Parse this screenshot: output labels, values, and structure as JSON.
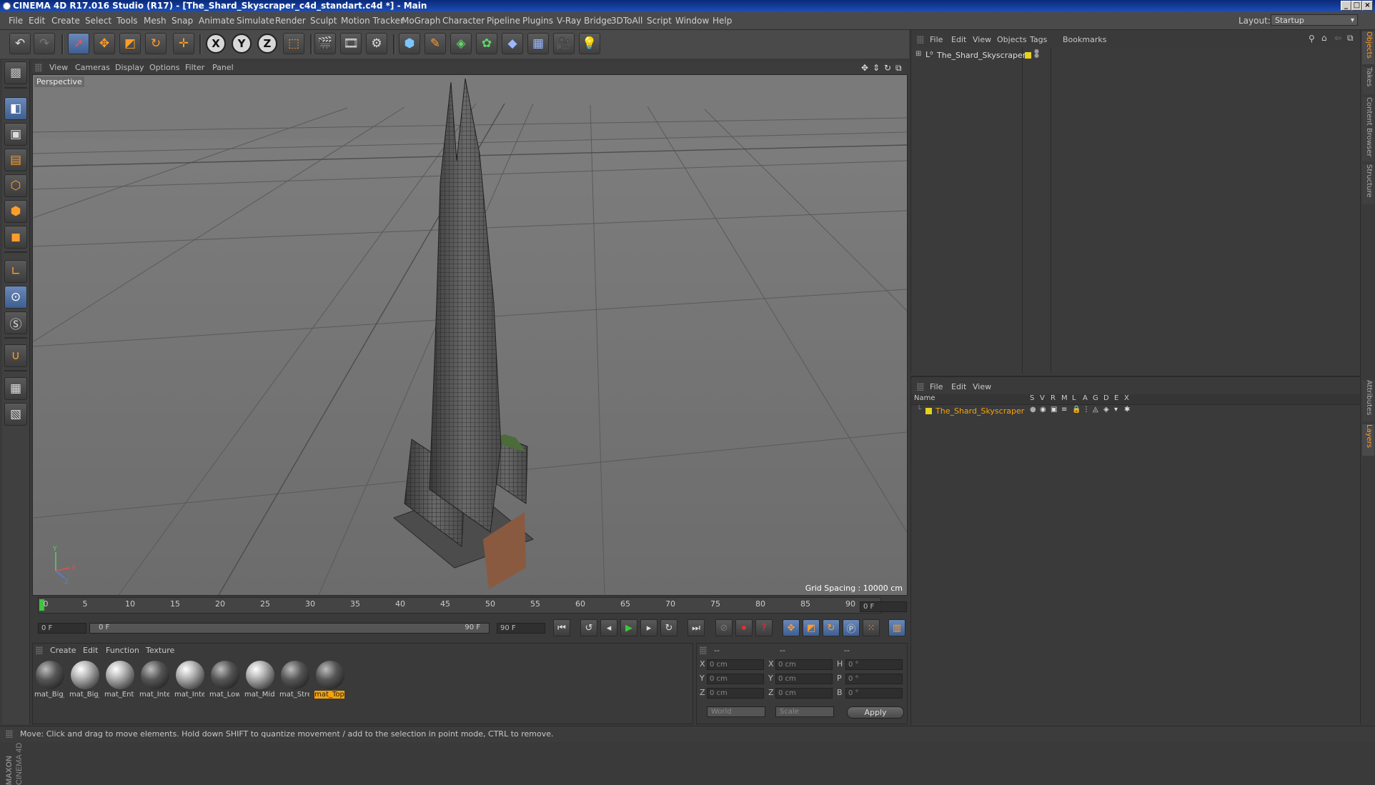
{
  "window": {
    "title": "CINEMA 4D R17.016 Studio (R17) - [The_Shard_Skyscraper_c4d_standart.c4d *] - Main"
  },
  "menubar": {
    "items": [
      "File",
      "Edit",
      "Create",
      "Select",
      "Tools",
      "Mesh",
      "Snap",
      "Animate",
      "Simulate",
      "Render",
      "Sculpt",
      "Motion Tracker",
      "MoGraph",
      "Character",
      "Pipeline",
      "Plugins",
      "V-Ray Bridge",
      "3DToAll",
      "Script",
      "Window",
      "Help"
    ],
    "layout_label": "Layout:",
    "layout_value": "Startup"
  },
  "viewport": {
    "menu": [
      "View",
      "Cameras",
      "Display",
      "Options",
      "Filter",
      "Panel"
    ],
    "label": "Perspective",
    "grid_spacing": "Grid Spacing : 10000 cm"
  },
  "timeline": {
    "ticks": [
      "0",
      "5",
      "10",
      "15",
      "20",
      "25",
      "30",
      "35",
      "40",
      "45",
      "50",
      "55",
      "60",
      "65",
      "70",
      "75",
      "80",
      "85",
      "90"
    ],
    "current_frame": "0 F",
    "start_frame": "0 F",
    "range_start": "0 F",
    "range_end": "90 F",
    "end_frame": "90 F"
  },
  "materials": {
    "menu": [
      "Create",
      "Edit",
      "Function",
      "Texture"
    ],
    "items": [
      "mat_Big_",
      "mat_Big_",
      "mat_Entr",
      "mat_Inte",
      "mat_Inte",
      "mat_Low",
      "mat_Midd",
      "mat_Stre",
      "mat_Top"
    ],
    "selected_index": 8
  },
  "coordinates": {
    "header": [
      "--",
      "--",
      "--"
    ],
    "pos": [
      {
        "axis": "X",
        "value": "0 cm"
      },
      {
        "axis": "Y",
        "value": "0 cm"
      },
      {
        "axis": "Z",
        "value": "0 cm"
      }
    ],
    "size": [
      {
        "axis": "X",
        "value": "0 cm"
      },
      {
        "axis": "Y",
        "value": "0 cm"
      },
      {
        "axis": "Z",
        "value": "0 cm"
      }
    ],
    "rot": [
      {
        "axis": "H",
        "value": "0 °"
      },
      {
        "axis": "P",
        "value": "0 °"
      },
      {
        "axis": "B",
        "value": "0 °"
      }
    ],
    "coord_system": "World",
    "mode": "Scale",
    "apply_label": "Apply"
  },
  "object_manager": {
    "menu": [
      "File",
      "Edit",
      "View",
      "Objects",
      "Tags",
      "Bookmarks"
    ],
    "object_name": "The_Shard_Skyscraper"
  },
  "layer_manager": {
    "menu": [
      "File",
      "Edit",
      "View"
    ],
    "columns": [
      "Name",
      "S",
      "V",
      "R",
      "M",
      "L",
      "A",
      "G",
      "D",
      "E",
      "X"
    ],
    "layer_name": "The_Shard_Skyscraper"
  },
  "right_tabs": [
    "Objects",
    "Takes",
    "Content Browser",
    "Structure",
    "Attributes",
    "Layers"
  ],
  "status": {
    "text": "Move: Click and drag to move elements. Hold down SHIFT to quantize movement / add to the selection in point mode, CTRL to remove."
  },
  "logo": {
    "line1": "MAXON",
    "line2": "CINEMA 4D"
  },
  "colors": {
    "accent_orange": "#ff9d2b",
    "selection_yellow": "#f7a30a",
    "layer_yellow": "#e6d21e",
    "titlebar_blue": "#1d4fb8"
  }
}
